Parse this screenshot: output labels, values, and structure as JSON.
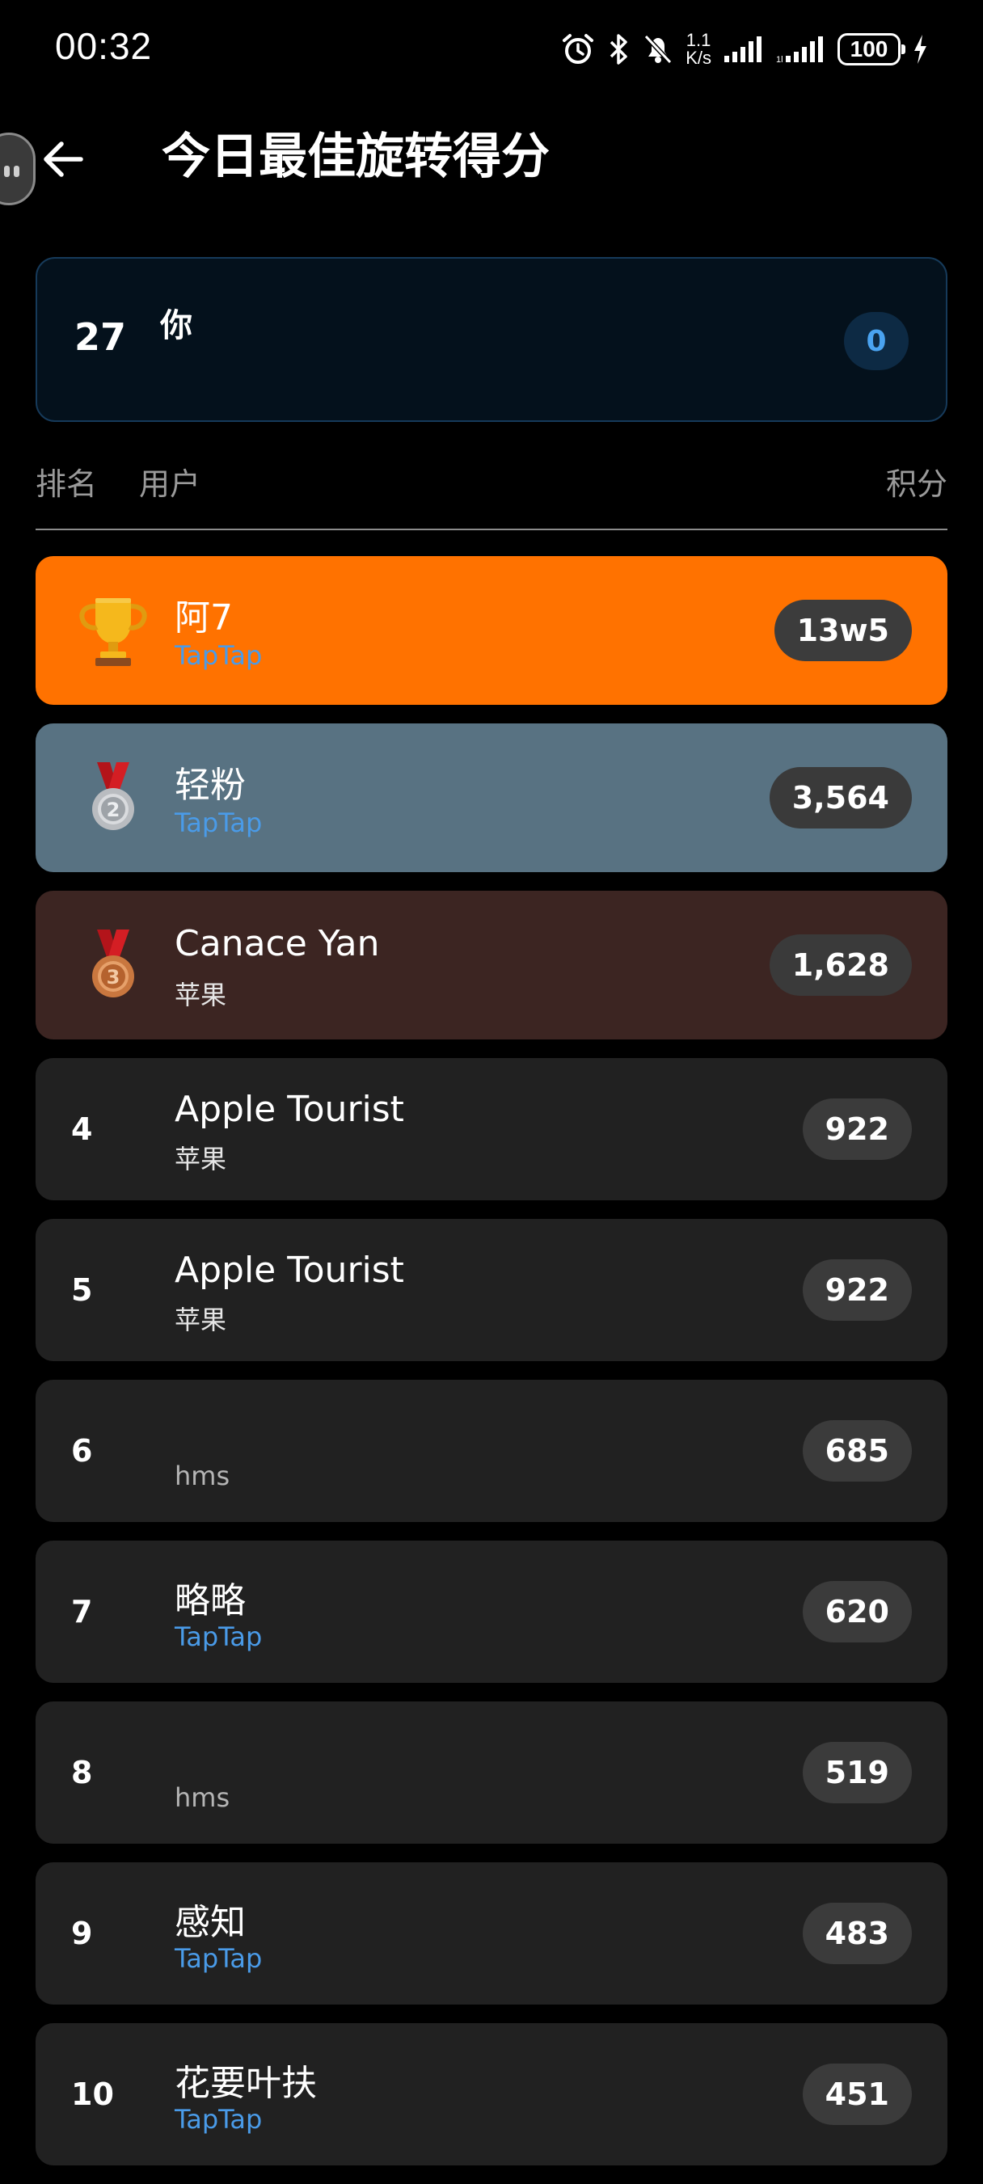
{
  "status_bar": {
    "time": "00:32",
    "net_speed_value": "1.1",
    "net_speed_unit": "K/s",
    "battery": "100"
  },
  "header": {
    "title": "今日最佳旋转得分"
  },
  "my_rank": {
    "rank": "27",
    "name": "你",
    "score": "0"
  },
  "columns": {
    "rank": "排名",
    "user": "用户",
    "score": "积分"
  },
  "rows": [
    {
      "rank": "1",
      "medal": "trophy-icon",
      "name": "阿7",
      "source": "TapTap",
      "score": "13w5"
    },
    {
      "rank": "2",
      "medal": "silver-medal-icon",
      "name": "轻粉",
      "source": "TapTap",
      "score": "3,564"
    },
    {
      "rank": "3",
      "medal": "bronze-medal-icon",
      "name": "Canace Yan",
      "source": "苹果",
      "score": "1,628"
    },
    {
      "rank": "4",
      "name": "Apple Tourist",
      "source": "苹果",
      "score": "922"
    },
    {
      "rank": "5",
      "name": "Apple Tourist",
      "source": "苹果",
      "score": "922"
    },
    {
      "rank": "6",
      "name": "",
      "source": "hms",
      "score": "685"
    },
    {
      "rank": "7",
      "name": "略略",
      "source": "TapTap",
      "score": "620"
    },
    {
      "rank": "8",
      "name": "",
      "source": "hms",
      "score": "519"
    },
    {
      "rank": "9",
      "name": "感知",
      "source": "TapTap",
      "score": "483"
    },
    {
      "rank": "10",
      "name": "花要叶扶",
      "source": "TapTap",
      "score": "451"
    }
  ],
  "colors": {
    "gold_row": "#ff7200",
    "silver_row": "#587282",
    "bronze_row": "#3c2522",
    "normal_row": "#212121",
    "taptap_source": "#4a9be8",
    "my_card_bg": "#04111c",
    "my_score": "#4aa3f0"
  }
}
